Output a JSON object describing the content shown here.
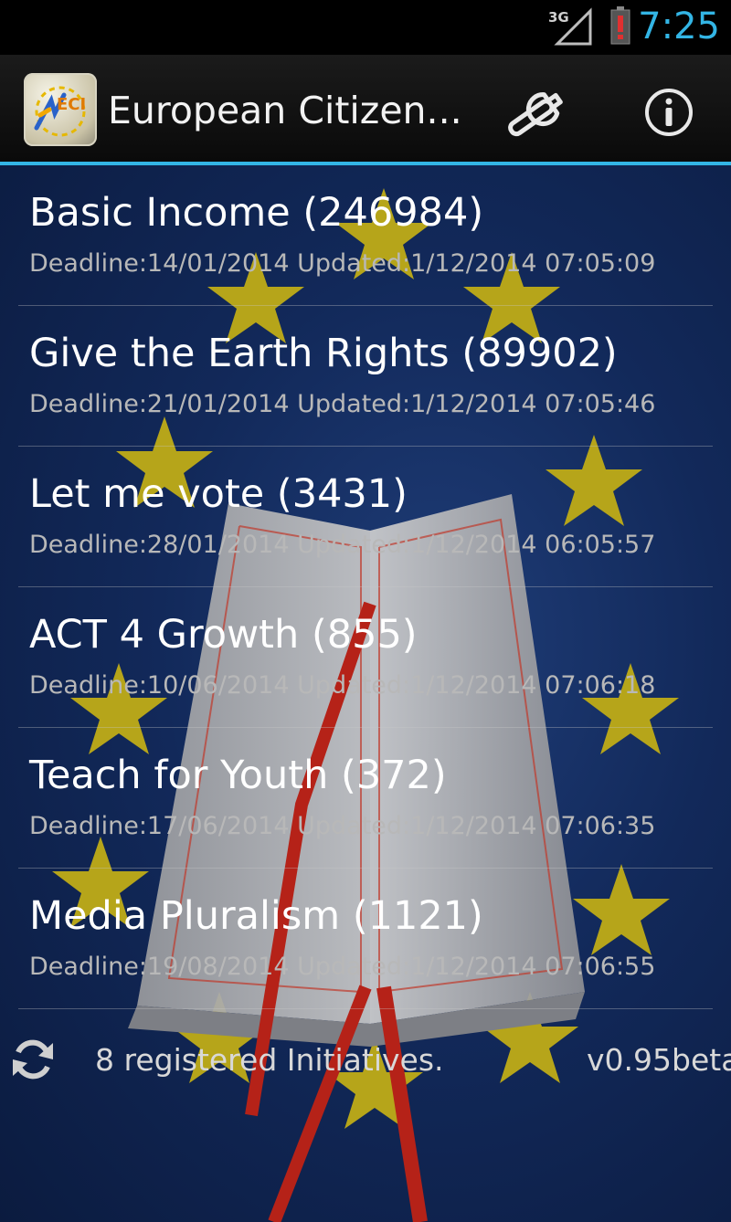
{
  "status_bar": {
    "network": "3G",
    "network_icon": "signal-3g-icon",
    "battery_icon": "battery-low-icon",
    "time": "7:25",
    "time_color": "#33b5e5"
  },
  "action_bar": {
    "logo_icon": "eci-logo-icon",
    "logo_text": "ECI",
    "title": "European Citizen...",
    "settings_icon": "wrench-icon",
    "info_icon": "info-icon",
    "accent": "#33b5e5"
  },
  "initiatives": [
    {
      "title": "Basic Income (246984)",
      "meta": "Deadline:14/01/2014 Updated:1/12/2014 07:05:09"
    },
    {
      "title": "Give the Earth Rights (89902)",
      "meta": "Deadline:21/01/2014 Updated:1/12/2014 07:05:46"
    },
    {
      "title": "Let me vote (3431)",
      "meta": "Deadline:28/01/2014 Updated:1/12/2014 06:05:57"
    },
    {
      "title": "ACT 4 Growth (855)",
      "meta": "Deadline:10/06/2014 Updated:1/12/2014 07:06:18"
    },
    {
      "title": "Teach for Youth (372)",
      "meta": "Deadline:17/06/2014 Updated:1/12/2014 07:06:35"
    },
    {
      "title": "Media Pluralism (1121)",
      "meta": "Deadline:19/08/2014 Updated:1/12/2014 07:06:55"
    }
  ],
  "footer": {
    "refresh_icon": "refresh-icon",
    "count_text": "8 registered Initiatives.",
    "version": "v0.95beta"
  }
}
